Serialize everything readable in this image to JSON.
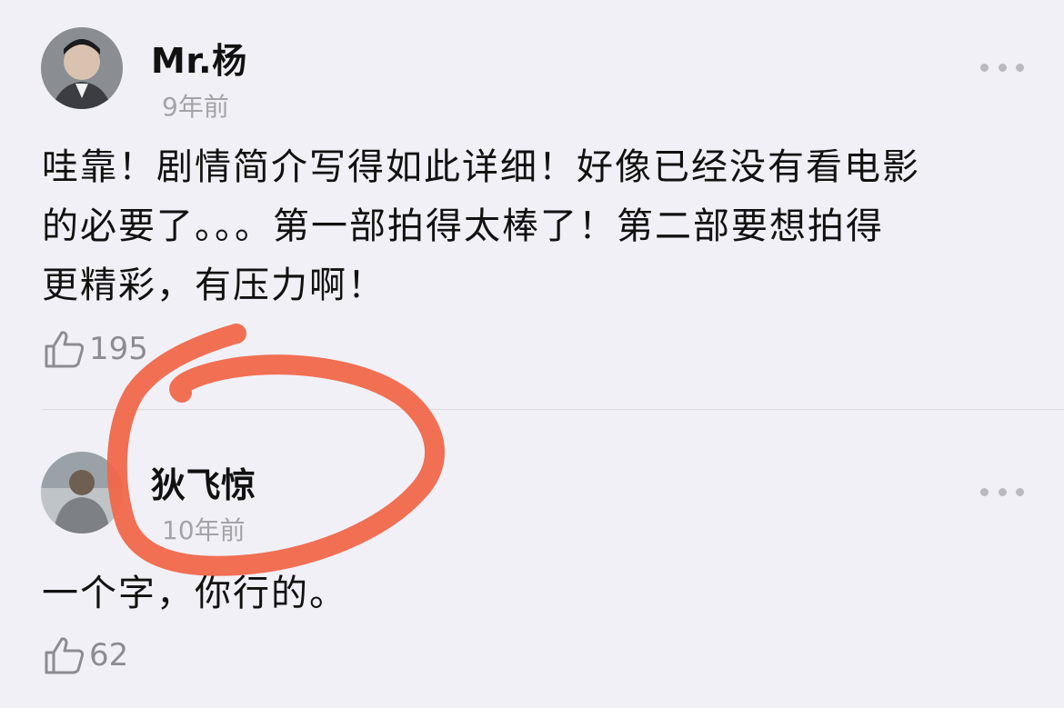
{
  "comments": [
    {
      "username": "Mr.杨",
      "time": "9年前",
      "text_lines": [
        "哇靠！剧情简介写得如此详细！好像已经没有看电影",
        "的必要了。。。第一部拍得太棒了！第二部要想拍得",
        "更精彩，有压力啊！"
      ],
      "likes": "195"
    },
    {
      "username": "狄飞惊",
      "time": "10年前",
      "text_lines": [
        "一个字，你行的。"
      ],
      "likes": "62"
    }
  ],
  "colors": {
    "background": "#f1f0f6",
    "annotation": "#f0674a",
    "muted_text": "#a3a3a8"
  },
  "icons": {
    "like": "thumbs-up-icon",
    "more": "more-dots-icon"
  }
}
